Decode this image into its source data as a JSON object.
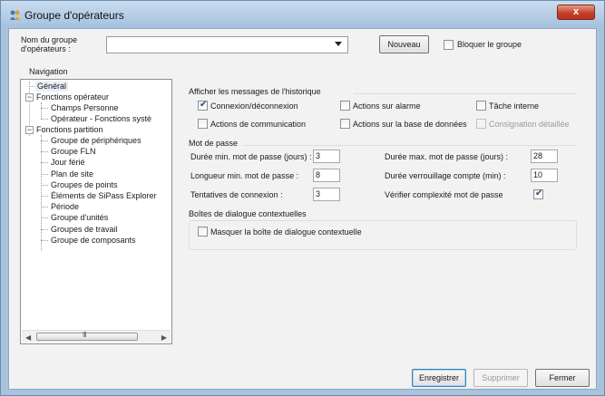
{
  "window": {
    "title": "Groupe d'opérateurs",
    "close_glyph": "x",
    "icon": "operator-group-app-icon"
  },
  "header": {
    "group_name_label": "Nom du groupe\nd'opérateurs :",
    "group_name_value": "",
    "new_button": "Nouveau",
    "lock_group_label": "Bloquer le groupe",
    "lock_group_checked": false
  },
  "navigation": {
    "label": "Navigation",
    "items": [
      {
        "label": "Général",
        "selected": true
      },
      {
        "label": "Fonctions opérateur",
        "expanded": true
      },
      {
        "label": "Champs Personne"
      },
      {
        "label": "Opérateur - Fonctions systè"
      },
      {
        "label": "Fonctions partition",
        "expanded": true
      },
      {
        "label": "Groupe de périphériques"
      },
      {
        "label": "Groupe FLN"
      },
      {
        "label": "Jour férié"
      },
      {
        "label": "Plan de site"
      },
      {
        "label": "Groupes de points"
      },
      {
        "label": "Éléments de SiPass Explorer"
      },
      {
        "label": "Période"
      },
      {
        "label": "Groupe d'unités"
      },
      {
        "label": "Groupes de travail"
      },
      {
        "label": "Groupe de composants"
      }
    ],
    "scrollbar_grip": "III"
  },
  "history": {
    "title": "Afficher les messages de l'historique",
    "options": [
      {
        "label": "Connexion/déconnexion",
        "checked": true,
        "enabled": true
      },
      {
        "label": "Actions sur alarme",
        "checked": false,
        "enabled": true
      },
      {
        "label": "Tâche interne",
        "checked": false,
        "enabled": true
      },
      {
        "label": "Actions de communication",
        "checked": false,
        "enabled": true
      },
      {
        "label": "Actions sur la base de données",
        "checked": false,
        "enabled": true
      },
      {
        "label": "Consignation détaillée",
        "checked": false,
        "enabled": false
      }
    ]
  },
  "password": {
    "title": "Mot de passe",
    "min_age_label": "Durée min. mot de passe (jours) :",
    "min_age_value": "3",
    "max_age_label": "Durée max. mot de passe (jours) :",
    "max_age_value": "28",
    "min_length_label": "Longueur min. mot de passe :",
    "min_length_value": "8",
    "lockout_label": "Durée verrouillage compte (min) :",
    "lockout_value": "10",
    "attempts_label": "Tentatives de connexion :",
    "attempts_value": "3",
    "complexity_label": "Vérifier complexité mot de passe",
    "complexity_checked": true
  },
  "dialogs": {
    "title": "Boîtes de dialogue contextuelles",
    "hide_popup_label": "Masquer la boîte de dialogue contextuelle",
    "hide_popup_checked": false
  },
  "footer": {
    "save": "Enregistrer",
    "delete": "Supprimer",
    "close": "Fermer"
  }
}
